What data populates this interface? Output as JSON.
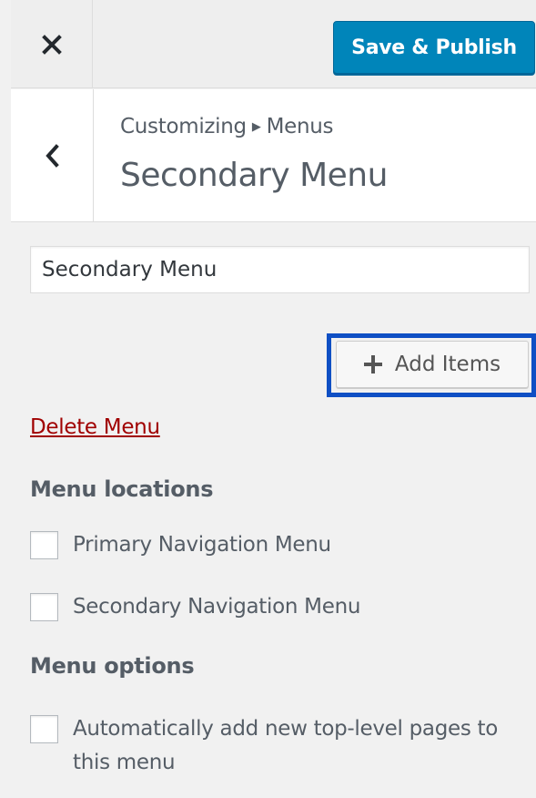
{
  "header": {
    "close_icon": "close-icon",
    "publish_label": "Save & Publish"
  },
  "section": {
    "back_icon": "chevron-left-icon",
    "breadcrumb": [
      "Customizing",
      "Menus"
    ],
    "title": "Secondary Menu"
  },
  "menu": {
    "name_value": "Secondary Menu",
    "add_items_label": "Add Items",
    "delete_label": "Delete Menu"
  },
  "locations": {
    "heading": "Menu locations",
    "items": [
      {
        "label": "Primary Navigation Menu",
        "checked": false
      },
      {
        "label": "Secondary Navigation Menu",
        "checked": false
      }
    ]
  },
  "options": {
    "heading": "Menu options",
    "auto_add_line1": "Automatically add new top-level pages to",
    "auto_add_line2": "this menu",
    "auto_add_checked": false
  },
  "colors": {
    "primary": "#0085ba",
    "highlight": "#0f4fc4",
    "delete": "#a00000"
  }
}
